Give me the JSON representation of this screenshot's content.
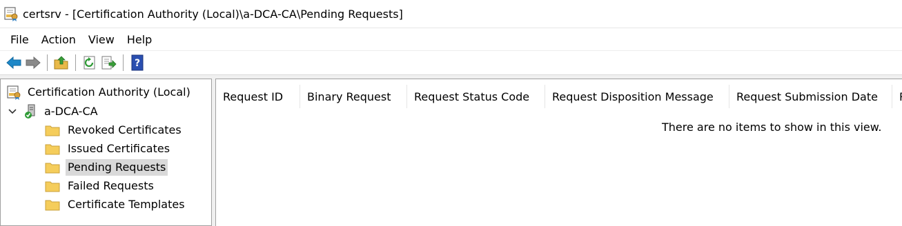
{
  "window": {
    "title": "certsrv - [Certification Authority (Local)\\a-DCA-CA\\Pending Requests]",
    "app_icon": "certsrv-icon"
  },
  "menu": {
    "items": [
      "File",
      "Action",
      "View",
      "Help"
    ]
  },
  "toolbar": {
    "buttons": [
      "back-arrow-icon",
      "forward-arrow-icon",
      "up-folder-icon",
      "refresh-icon",
      "export-list-icon",
      "help-icon"
    ]
  },
  "tree": {
    "root": "Certification Authority (Local)",
    "ca": "a-DCA-CA",
    "children": [
      "Revoked Certificates",
      "Issued Certificates",
      "Pending Requests",
      "Failed Requests",
      "Certificate Templates"
    ],
    "selected": "Pending Requests"
  },
  "list": {
    "columns": [
      "Request ID",
      "Binary Request",
      "Request Status Code",
      "Request Disposition Message",
      "Request Submission Date",
      "R"
    ],
    "empty_message": "There are no items to show in this view."
  },
  "colors": {
    "selection": "#d9d9d9",
    "arrow_blue": "#1e88c8",
    "arrow_gray": "#8a8a8a",
    "folder_yellow": "#f5cd5b",
    "help_blue": "#2a4fb0"
  }
}
